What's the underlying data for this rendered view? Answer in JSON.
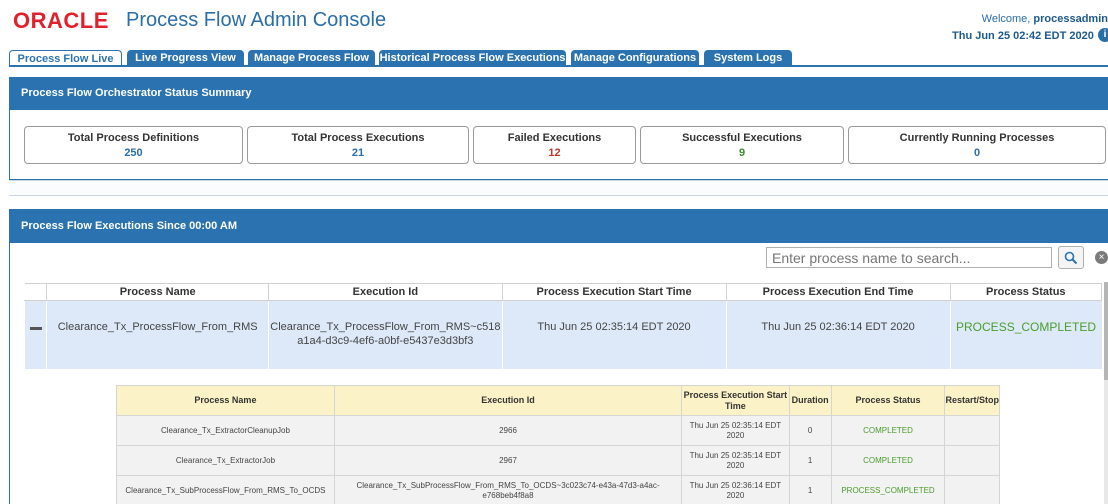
{
  "header": {
    "logo": "ORACLE",
    "title": "Process Flow Admin Console",
    "welcome_prefix": "Welcome, ",
    "username": "processadmin",
    "datetime": "Thu Jun 25 02:42 EDT 2020",
    "info_icon": "info-icon"
  },
  "tabs": [
    {
      "label": "Process Flow Live",
      "active": true
    },
    {
      "label": "Live Progress View"
    },
    {
      "label": "Manage Process Flow"
    },
    {
      "label": "Historical Process Flow Executions"
    },
    {
      "label": "Manage Configurations"
    },
    {
      "label": "System Logs"
    }
  ],
  "summary": {
    "heading": "Process Flow Orchestrator Status Summary",
    "stats": [
      {
        "label": "Total Process Definitions",
        "value": "250",
        "color": "#2a6ea8"
      },
      {
        "label": "Total Process Executions",
        "value": "21",
        "color": "#2a6ea8"
      },
      {
        "label": "Failed Executions",
        "value": "12",
        "color": "#c0392b"
      },
      {
        "label": "Successful Executions",
        "value": "9",
        "color": "#3c8c28"
      },
      {
        "label": "Currently Running Processes",
        "value": "0",
        "color": "#2a6ea8"
      }
    ]
  },
  "executions": {
    "heading": "Process Flow Executions Since 00:00 AM",
    "search_placeholder": "Enter process name to search...",
    "columns": [
      "Process Name",
      "Execution Id",
      "Process Execution Start Time",
      "Process Execution End Time",
      "Process Status"
    ],
    "row": {
      "process_name": "Clearance_Tx_ProcessFlow_From_RMS",
      "execution_id_line1": "Clearance_Tx_ProcessFlow_From_RMS~c518",
      "execution_id_line2": "a1a4-d3c9-4ef6-a0bf-e5437e3d3bf3",
      "start_time": "Thu Jun 25 02:35:14 EDT 2020",
      "end_time": "Thu Jun 25 02:36:14 EDT 2020",
      "status": "PROCESS_COMPLETED"
    }
  },
  "sub_executions": {
    "columns": [
      "Process Name",
      "Execution Id",
      "Process Execution Start Time",
      "Duration",
      "Process Status",
      "Restart/Stop"
    ],
    "rows": [
      {
        "name": "Clearance_Tx_ExtractorCleanupJob",
        "id_line1": "2966",
        "id_line2": "",
        "start_line1": "Thu Jun 25 02:35:14 EDT",
        "start_line2": "2020",
        "duration": "0",
        "status": "COMPLETED",
        "restart": ""
      },
      {
        "name": "Clearance_Tx_ExtractorJob",
        "id_line1": "2967",
        "id_line2": "",
        "start_line1": "Thu Jun 25 02:35:14 EDT",
        "start_line2": "2020",
        "duration": "1",
        "status": "COMPLETED",
        "restart": ""
      },
      {
        "name": "Clearance_Tx_SubProcessFlow_From_RMS_To_OCDS",
        "id_line1": "Clearance_Tx_SubProcessFlow_From_RMS_To_OCDS~3c023c74-e43a-47d3-a4ac-",
        "id_line2": "e768beb4f8a8",
        "start_line1": "Thu Jun 25 02:36:14 EDT",
        "start_line2": "2020",
        "duration": "1",
        "status": "PROCESS_COMPLETED",
        "restart": ""
      }
    ]
  }
}
